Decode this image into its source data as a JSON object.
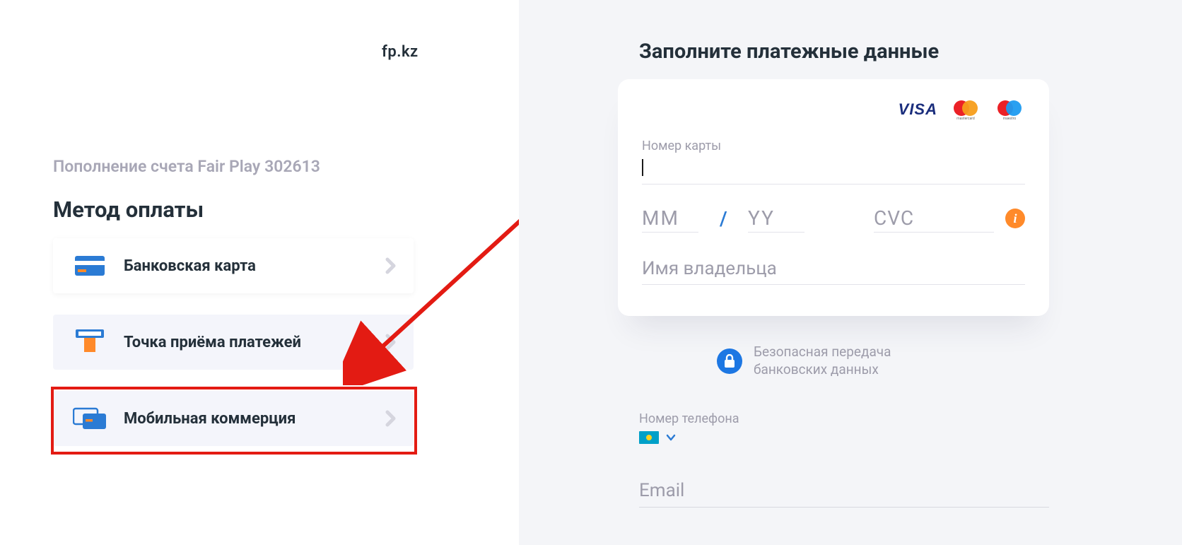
{
  "left": {
    "domain": "fp.kz",
    "topup_label": "Пополнение счета Fair Play 302613",
    "method_title": "Метод оплаты",
    "methods": [
      {
        "label": "Банковская карта"
      },
      {
        "label": "Точка приёма платежей"
      },
      {
        "label": "Мобильная коммерция"
      }
    ]
  },
  "right": {
    "form_title": "Заполните платежные данные",
    "card_number_label": "Номер карты",
    "exp_mm_placeholder": "MM",
    "exp_yy_placeholder": "YY",
    "cvc_placeholder": "CVC",
    "holder_placeholder": "Имя владельца",
    "secure_line1": "Безопасная передача",
    "secure_line2": "банковских данных",
    "phone_label": "Номер телефона",
    "email_placeholder": "Email",
    "brands": {
      "visa": "VISA",
      "mastercard": "mastercard",
      "maestro": "maestro"
    }
  },
  "colors": {
    "danger": "#e31b13",
    "accent_blue": "#2b7bd4",
    "accent_orange": "#ff8a2a"
  }
}
